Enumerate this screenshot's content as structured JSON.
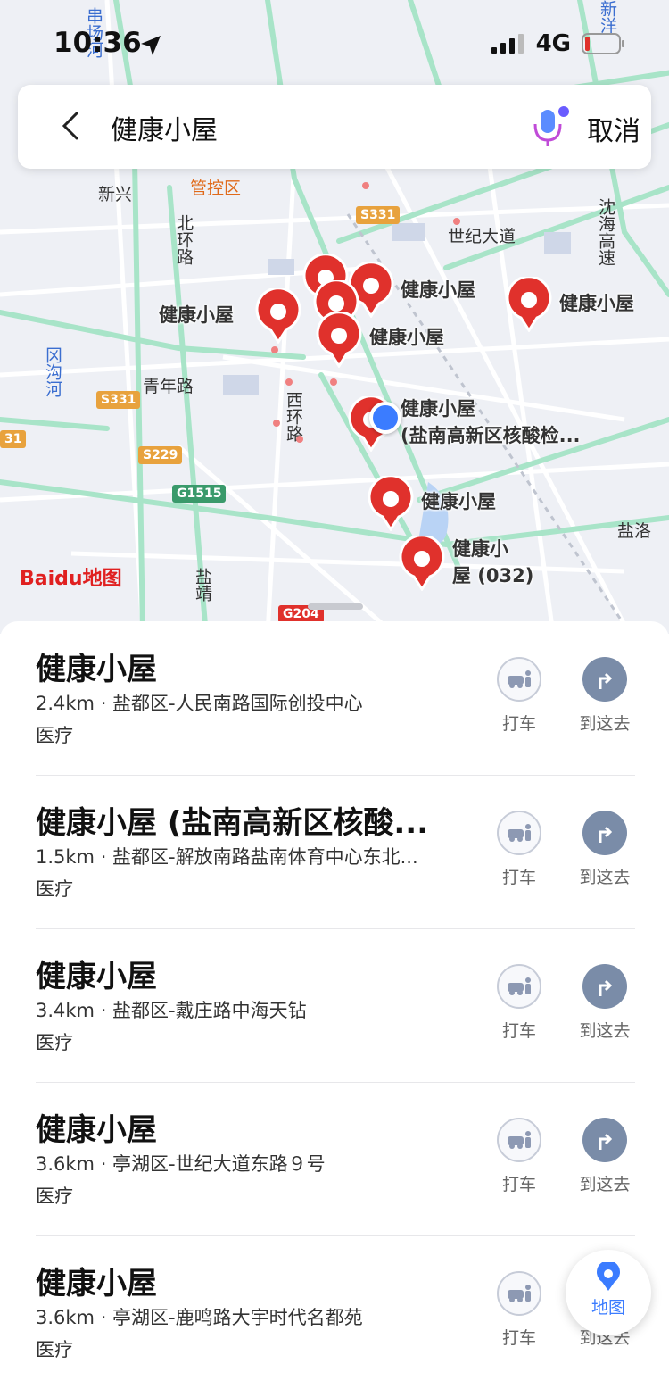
{
  "status_bar": {
    "time": "10:36",
    "network": "4G"
  },
  "search": {
    "query": "健康小屋",
    "cancel_label": "取消"
  },
  "map": {
    "logo": "Baidu地图",
    "road_labels": [
      "新兴",
      "北环路",
      "冈沟河",
      "青年路",
      "西环路",
      "世纪大道",
      "沈海高速",
      "盐洛",
      "盐靖",
      "管控区",
      "串场河",
      "新洋"
    ],
    "road_tags": [
      "S331",
      "S331",
      "S229",
      "G1515",
      "G204",
      "31"
    ],
    "pins": [
      {
        "label": "健康小屋"
      },
      {
        "label": "健康小屋"
      },
      {
        "label": "健康小屋"
      },
      {
        "label": "健康小屋"
      },
      {
        "label": "健康小屋"
      },
      {
        "label": "(盐南高新区核酸检..."
      },
      {
        "label": "健康小屋"
      },
      {
        "label": "健康小"
      },
      {
        "label": "屋 (032)"
      }
    ]
  },
  "results": [
    {
      "name": "健康小屋",
      "detail": "2.4km · 盐都区-人民南路国际创投中心",
      "category": "医疗"
    },
    {
      "name": "健康小屋 (盐南高新区核酸...",
      "detail": "1.5km · 盐都区-解放南路盐南体育中心东北...",
      "category": "医疗"
    },
    {
      "name": "健康小屋",
      "detail": "3.4km · 盐都区-戴庄路中海天钻",
      "category": "医疗"
    },
    {
      "name": "健康小屋",
      "detail": "3.6km · 亭湖区-世纪大道东路９号",
      "category": "医疗"
    },
    {
      "name": "健康小屋",
      "detail": "3.6km · 亭湖区-鹿鸣路大宇时代名都苑",
      "category": "医疗"
    }
  ],
  "actions": {
    "taxi_label": "打车",
    "go_label": "到这去"
  },
  "fab": {
    "label": "地图"
  },
  "colors": {
    "accent": "#3b7cff",
    "pin": "#e0312c",
    "road": "#8fd9b6"
  }
}
